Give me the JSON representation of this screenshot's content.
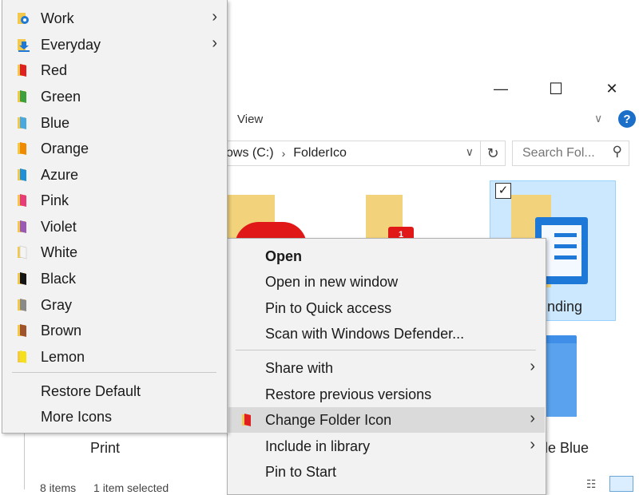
{
  "window": {
    "ribbon_tab": "View",
    "address": {
      "crumb1": "ows (C:)",
      "crumb2": "FolderIco",
      "sep": "›"
    },
    "search_placeholder": "Search Fol...",
    "minimize_glyph": "—",
    "maximize_glyph": "☐",
    "close_glyph": "✕",
    "help_glyph": "?",
    "refresh_glyph": "↻",
    "chevron_glyph": "∨",
    "dropdown_glyph": "∨",
    "search_glyph": "⚲"
  },
  "tiles": {
    "selected_label": "nding",
    "blue_label": "le Blue",
    "print_label": "Print",
    "check_glyph": "✓"
  },
  "status": {
    "items": "8 items",
    "selected": "1 item selected"
  },
  "context_menu": {
    "open": "Open",
    "open_new_window": "Open in new window",
    "pin_quick_access": "Pin to Quick access",
    "scan_defender": "Scan with Windows Defender...",
    "share_with": "Share with",
    "restore_previous": "Restore previous versions",
    "change_folder_icon": "Change Folder Icon",
    "include_library": "Include in library",
    "pin_start": "Pin to Start",
    "arrow_glyph": "›"
  },
  "submenu": {
    "items": [
      {
        "label": "Work",
        "color": "#f2c94c",
        "icon": "gear-folder-icon"
      },
      {
        "label": "Everyday",
        "color": "#f2c94c",
        "icon": "download-folder-icon"
      },
      {
        "label": "Red",
        "color": "#e02020"
      },
      {
        "label": "Green",
        "color": "#3ca03c"
      },
      {
        "label": "Blue",
        "color": "#4aa8e0"
      },
      {
        "label": "Orange",
        "color": "#f08a00"
      },
      {
        "label": "Azure",
        "color": "#1e90d8"
      },
      {
        "label": "Pink",
        "color": "#e83c78"
      },
      {
        "label": "Violet",
        "color": "#9b59b6"
      },
      {
        "label": "White",
        "color": "#f4f4f4"
      },
      {
        "label": "Black",
        "color": "#151515"
      },
      {
        "label": "Gray",
        "color": "#8a8a8a"
      },
      {
        "label": "Brown",
        "color": "#a0522d"
      },
      {
        "label": "Lemon",
        "color": "#f5e11b"
      }
    ],
    "restore_default": "Restore Default",
    "more_icons": "More Icons",
    "arrow_glyph": "›"
  },
  "colors": {
    "accent": "#1c6fc9",
    "selection": "#cce8ff",
    "menu_bg": "#f2f2f2",
    "highlight": "#dadada"
  }
}
